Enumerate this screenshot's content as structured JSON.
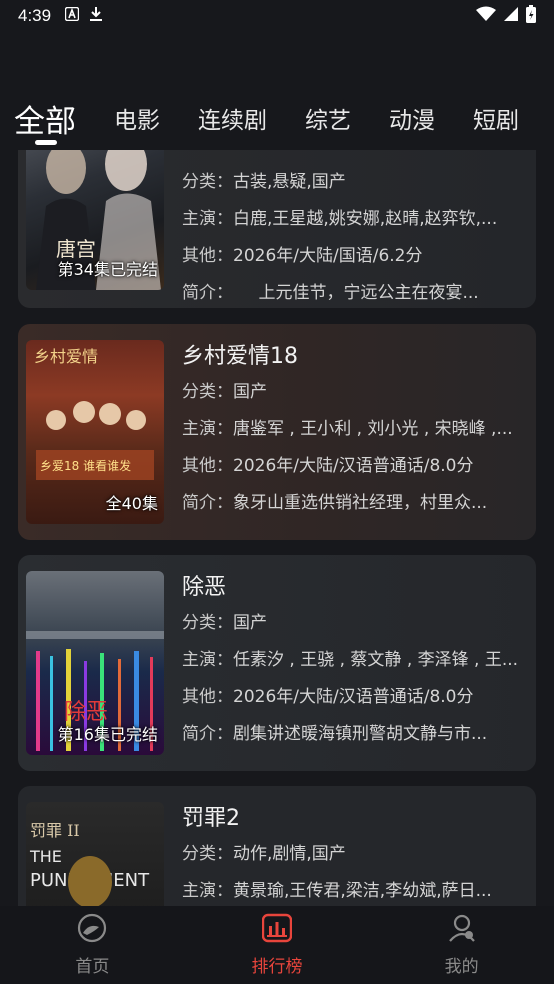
{
  "status": {
    "time": "4:39"
  },
  "tabs": [
    "全部",
    "电影",
    "连续剧",
    "综艺",
    "动漫",
    "短剧"
  ],
  "items": [
    {
      "title": "",
      "category_label": "分类：",
      "category": "古装,悬疑,国产",
      "cast_label": "主演：",
      "cast": "白鹿,王星越,姚安娜,赵晴,赵弈钦,...",
      "other_label": "其他：",
      "other": "2026年/大陆/国语/6.2分",
      "intro_label": "简介：",
      "intro": "　　上元佳节，宁远公主在夜宴...",
      "badge": "第34集已完结"
    },
    {
      "title": "乡村爱情18",
      "category_label": "分类：",
      "category": "国产",
      "cast_label": "主演：",
      "cast": "唐鉴军 , 王小利 , 刘小光 , 宋晓峰 ,...",
      "other_label": "其他：",
      "other": "2026年/大陆/汉语普通话/8.0分",
      "intro_label": "简介：",
      "intro": "象牙山重选供销社经理，村里众...",
      "badge": "全40集"
    },
    {
      "title": "除恶",
      "category_label": "分类：",
      "category": "国产",
      "cast_label": "主演：",
      "cast": "任素汐 , 王骁 , 蔡文静 , 李泽锋 , 王...",
      "other_label": "其他：",
      "other": "2026年/大陆/汉语普通话/8.0分",
      "intro_label": "简介：",
      "intro": "剧集讲述暖海镇刑警胡文静与市...",
      "badge": "第16集已完结"
    },
    {
      "title": "罚罪2",
      "category_label": "分类：",
      "category": "动作,剧情,国产",
      "cast_label": "主演：",
      "cast": "黄景瑜,王传君,梁洁,李幼斌,萨日...",
      "other_label": "",
      "other": "",
      "intro_label": "",
      "intro": "",
      "badge": ""
    }
  ],
  "nav": [
    {
      "label": "首页",
      "icon": "home-icon"
    },
    {
      "label": "排行榜",
      "icon": "ranking-icon"
    },
    {
      "label": "我的",
      "icon": "profile-icon"
    }
  ],
  "colors": {
    "accent": "#e8453c",
    "background": "#17181c",
    "card": "#25272b"
  }
}
